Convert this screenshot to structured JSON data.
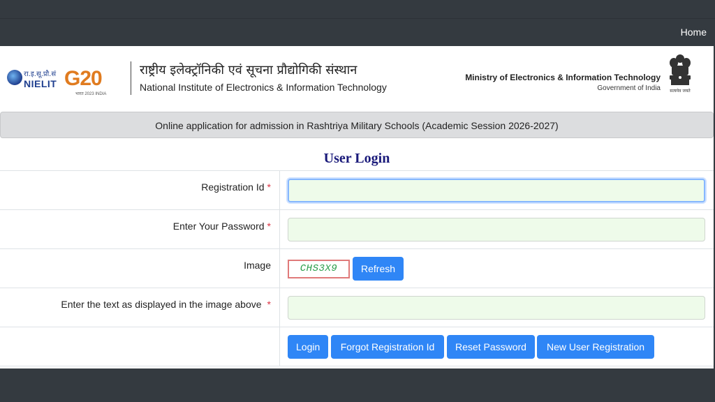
{
  "nav": {
    "home_label": "Home"
  },
  "header": {
    "nielit_hindi": "रा.इ.सू.प्रौ.सं",
    "nielit_english": "NIELIT",
    "g20_text": "G20",
    "g20_sub": "भारत 2023 INDIA",
    "title_hindi": "राष्ट्रीय इलेक्ट्रॉनिकी एवं सूचना प्रौद्योगिकी संस्थान",
    "title_english": "National Institute of Electronics & Information Technology",
    "ministry": "Ministry of Electronics & Information Technology",
    "government": "Government of India",
    "emblem_motto": "सत्यमेव जयते"
  },
  "banner": {
    "text": "Online application for admission in Rashtriya Military Schools (Academic Session 2026-2027)"
  },
  "login": {
    "title": "User Login",
    "fields": {
      "registration_id": {
        "label": "Registration Id",
        "value": ""
      },
      "password": {
        "label": "Enter Your Password",
        "value": ""
      },
      "image": {
        "label": "Image",
        "captcha_text": "CHS3X9",
        "refresh_label": "Refresh"
      },
      "captcha_input": {
        "label": "Enter the text as displayed in the image above",
        "value": ""
      }
    },
    "required_marker": "*",
    "buttons": {
      "login": "Login",
      "forgot": "Forgot Registration Id",
      "reset": "Reset Password",
      "new_user": "New User Registration"
    }
  },
  "colors": {
    "navbar": "#343a40",
    "banner": "#dcdddf",
    "primary_button": "#2f86f6",
    "input_background": "#eefbea",
    "title": "#1a1a7a",
    "required": "#dc3545"
  }
}
